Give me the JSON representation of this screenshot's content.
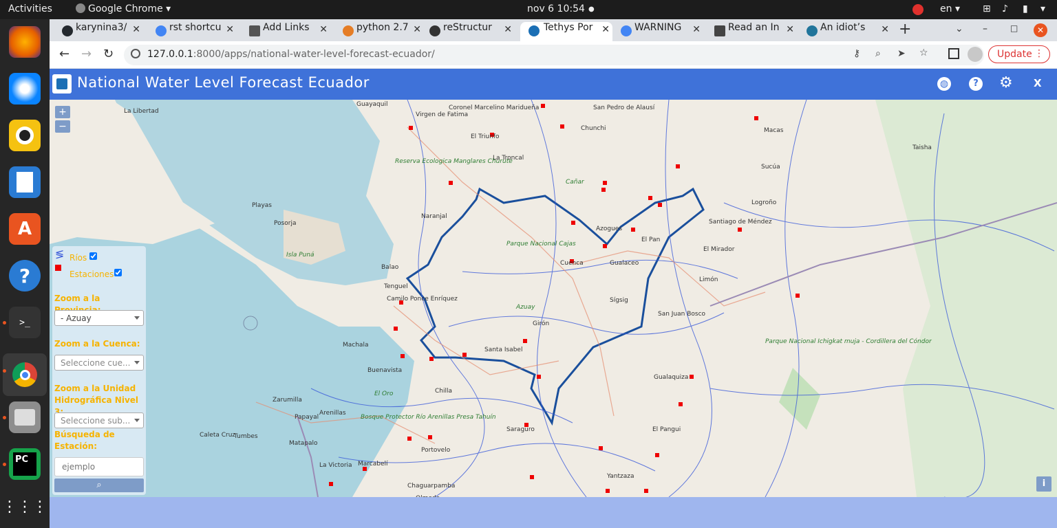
{
  "topbar": {
    "activities": "Activities",
    "app": "Google Chrome",
    "clock": "nov 6  10:54",
    "lang": "en"
  },
  "dock": {
    "items": [
      "firefox-icon",
      "thunderbird-icon",
      "rhythmbox-icon",
      "libreoffice-writer-icon",
      "software-icon",
      "help-icon",
      "terminal-icon",
      "chrome-icon",
      "files-icon",
      "pycharm-icon",
      "apps-grid-icon"
    ]
  },
  "tabs": [
    {
      "label": "karynina3/",
      "color": "#24292e"
    },
    {
      "label": "rst shortcu",
      "color": "#4285f4"
    },
    {
      "label": "Add Links",
      "color": "#555"
    },
    {
      "label": "python 2.7",
      "color": "#e57d26"
    },
    {
      "label": "reStructur",
      "color": "#333"
    },
    {
      "label": "Tethys Por",
      "color": "#1b6fb5"
    },
    {
      "label": "WARNING",
      "color": "#4285f4"
    },
    {
      "label": "Read an In",
      "color": "#444"
    },
    {
      "label": "An idiot’s",
      "color": "#21759b"
    }
  ],
  "url": {
    "host": "127.0.0.1",
    "rest": ":8000/apps/national-water-level-forecast-ecuador/"
  },
  "update_label": "Update",
  "app_title": "National Water Level Forecast Ecuador",
  "app_close": "X",
  "zoom": {
    "plus": "+",
    "minus": "−"
  },
  "info_label": "i",
  "panel": {
    "rios": "Ríos",
    "estaciones": "Estaciones",
    "zoom_prov": "Zoom a la Provincia:",
    "prov_value": "- Azuay",
    "zoom_cuenca": "Zoom a la Cuenca:",
    "cuenca_value": "Seleccione cue...",
    "zoom_unidad": "Zoom a la Unidad Hidrográfica Nivel 3:",
    "unidad_value": "Seleccione sub...",
    "busqueda": "Búsqueda de Estación:",
    "busqueda_placeholder": "ejemplo"
  },
  "places": [
    "Guayaquil",
    "La Libertad",
    "Virgen de Fatima",
    "Coronel Marcelino Maridueña",
    "El Triunfo",
    "La Troncal",
    "Chunchi",
    "San Pedro de Alausí",
    "Macas",
    "Taisha",
    "Reserva Ecologica Manglares Churute",
    "Cañar",
    "Playas",
    "Posorja",
    "Naranjal",
    "Azogues",
    "Sucúa",
    "Logroño",
    "Santiago de Méndez",
    "El Pan",
    "Isla Puná",
    "Parque Nacional Cajas",
    "Cuenca",
    "Gualaceo",
    "El Mirador",
    "Balao",
    "Limón",
    "Tenguel",
    "Camilo Ponce Enríquez",
    "Sígsig",
    "Azuay",
    "San Juan Bosco",
    "Girón",
    "Machala",
    "Santa Isabel",
    "Parque Nacional Ichigkat muja - Cordillera del Cóndor",
    "Buenavista",
    "Chilla",
    "Gualaquiza",
    "El Oro",
    "Zarumilla",
    "Tumbes",
    "Papayal",
    "Arenillas",
    "Bosque Protector Río Arenillas Presa Tahuín",
    "Caleta Cruz",
    "Saraguro",
    "El Pangui",
    "Matapalo",
    "Portovelo",
    "La Victoria",
    "Marcabelí",
    "Yantzaza",
    "Chaguarpamba",
    "Olmedo"
  ]
}
